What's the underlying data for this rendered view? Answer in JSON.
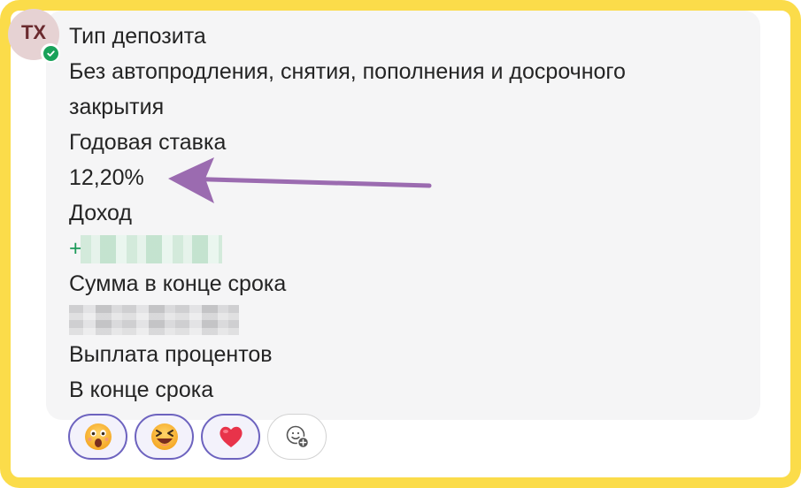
{
  "author": {
    "initials": "TX",
    "status": "online",
    "avatar_bg": "#e6d2d3",
    "status_color": "#1aa25a"
  },
  "message": {
    "lines": [
      "Тип депозита",
      "Без автопродления, снятия, пополнения и досрочного",
      "закрытия",
      "Годовая ставка",
      "12,20%",
      "Доход",
      "+",
      "Сумма в конце срока",
      "",
      "Выплата процентов",
      "В конце срока"
    ],
    "income_prefix_color": "#1d9a5a",
    "redacted_fields": [
      "income-amount",
      "final-sum"
    ]
  },
  "annotation": {
    "arrow_color": "#9b6bb0",
    "points_to": "annual-rate-value"
  },
  "reactions": [
    {
      "icon": "astonished-face-icon",
      "selected": true
    },
    {
      "icon": "laughing-face-icon",
      "selected": true
    },
    {
      "icon": "red-heart-icon",
      "selected": true
    },
    {
      "icon": "add-reaction-icon",
      "selected": false
    }
  ],
  "colors": {
    "frame": "#fbdc4a",
    "bubble": "#f5f5f6",
    "reaction_border": "#6d63bf"
  }
}
